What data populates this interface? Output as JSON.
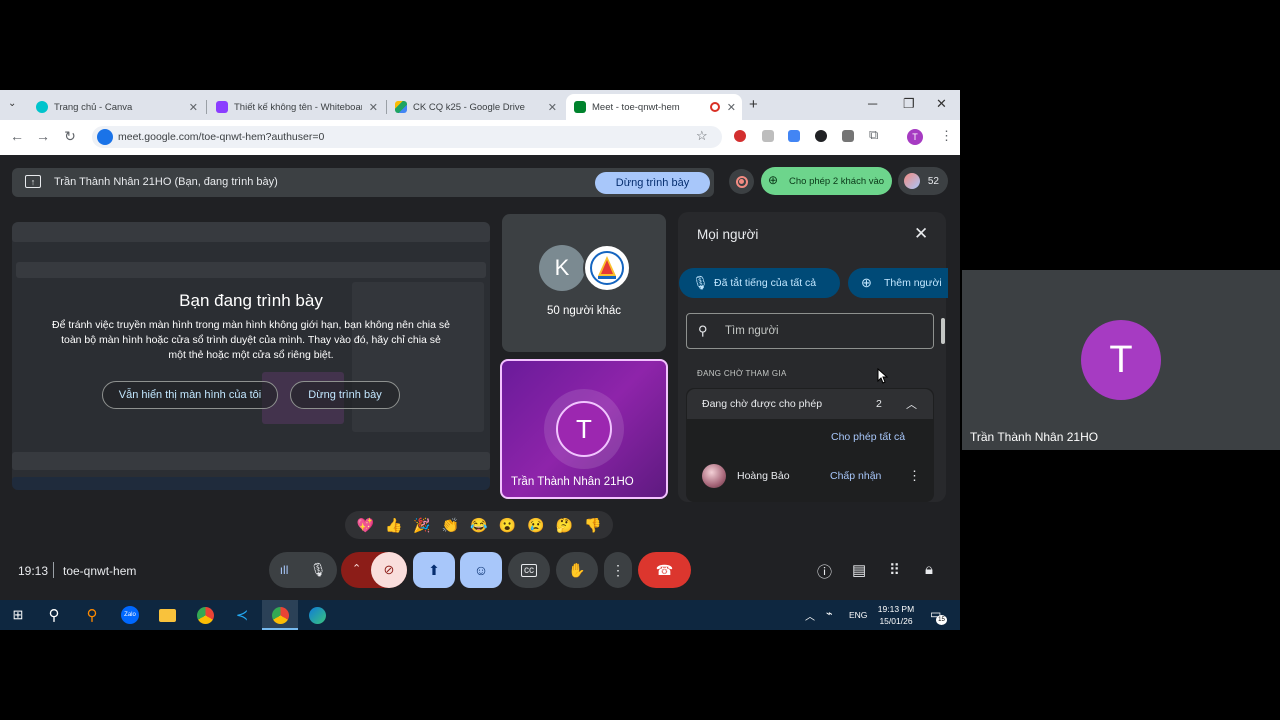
{
  "browser": {
    "tabs": [
      {
        "title": "Trang chủ - Canva",
        "color": "#00c4cc"
      },
      {
        "title": "Thiết kế không tên - Whiteboard",
        "color": "#8b3dff"
      },
      {
        "title": "CK CQ k25 - Google Drive",
        "color": "#1fa463"
      },
      {
        "title": "Meet - toe-qnwt-hem",
        "color": "#00832d"
      }
    ],
    "url": "meet.google.com/toe-qnwt-hem?authuser=0",
    "profile_letter": "T"
  },
  "presentation_bar": {
    "text": "Trần Thành Nhân 21HO (Bạn, đang trình bày)",
    "stop_label": "Dừng trình bày"
  },
  "top_controls": {
    "admit_label": "Cho phép 2 khách vào",
    "participant_count": "52"
  },
  "self_preview": {
    "title": "Bạn đang trình bày",
    "body": "Để tránh việc truyền màn hình trong màn hình không giới hạn, bạn không nên chia sẻ toàn bộ màn hình hoặc cửa sổ trình duyệt của mình. Thay vào đó, hãy chỉ chia sẻ một thẻ hoặc một cửa sổ riêng biệt.",
    "keep_showing_label": "Vẫn hiển thị màn hình của tôi",
    "stop_label": "Dừng trình bày"
  },
  "tiles": {
    "others_initial": "K",
    "others_label": "50 người khác",
    "self_initial": "T",
    "self_name": "Trần Thành Nhân 21HO"
  },
  "people_panel": {
    "title": "Mọi người",
    "mute_all_label": "Đã tắt tiếng của tất cả",
    "add_people_label": "Thêm người",
    "search_placeholder": "Tìm người",
    "waiting_section": "ĐANG CHỜ THAM GIA",
    "waiting_label": "Đang chờ được cho phép",
    "waiting_count": "2",
    "admit_all_label": "Cho phép tất cả",
    "waiting_people": [
      {
        "name": "Hoàng Bảo",
        "accept_label": "Chấp nhận"
      }
    ]
  },
  "reactions": [
    "💖",
    "👍",
    "🎉",
    "👏",
    "😂",
    "😮",
    "😢",
    "🤔",
    "👎"
  ],
  "bottom_bar": {
    "time": "19:13",
    "meeting_code": "toe-qnwt-hem"
  },
  "taskbar": {
    "lang": "ENG",
    "time": "19:13 PM",
    "date": "15/01/26",
    "notification_count": "15"
  },
  "right_tile": {
    "initial": "T",
    "name": "Trần Thành Nhân 21HO"
  },
  "colors": {
    "meet_bg": "#202124",
    "accent_blue": "#a8c7fa",
    "admit_green": "#6dd58c",
    "end_call_red": "#dc362e",
    "self_purple": "#8e24aa"
  }
}
